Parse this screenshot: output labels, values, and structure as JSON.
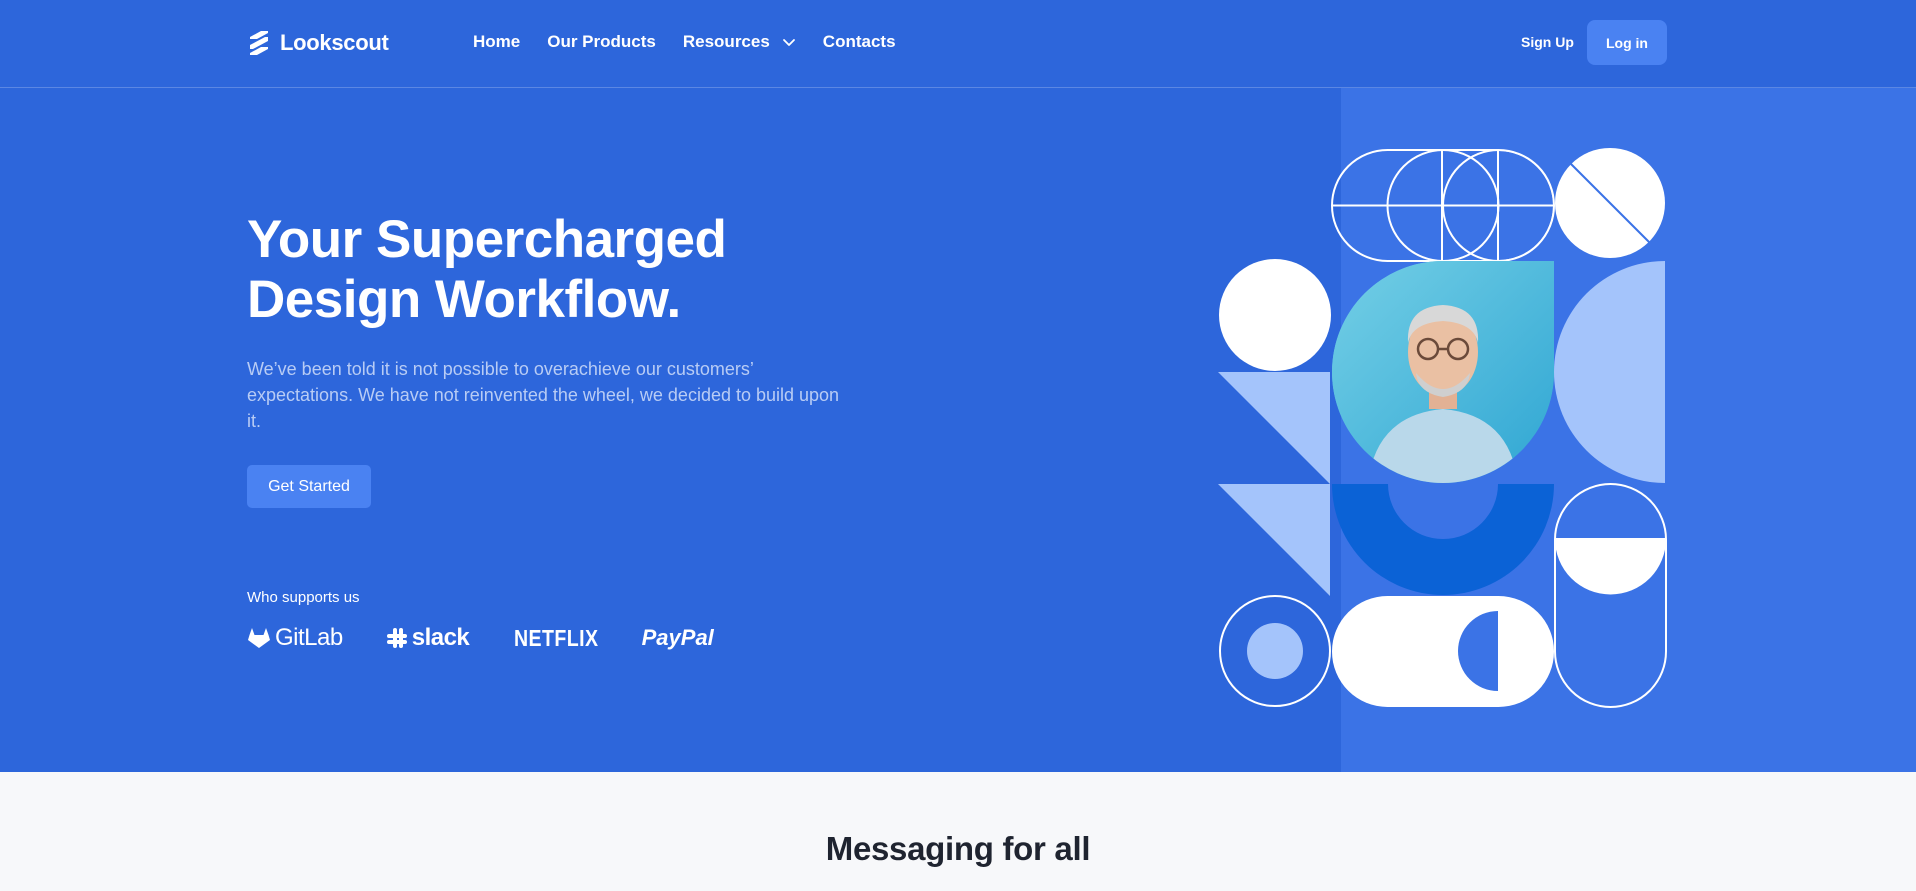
{
  "brand": {
    "name": "Lookscout",
    "logo_icon": "logo-stripes-icon"
  },
  "nav": {
    "items": [
      {
        "label": "Home"
      },
      {
        "label": "Our Products"
      },
      {
        "label": "Resources",
        "has_dropdown": true,
        "icon": "chevron-down-icon"
      },
      {
        "label": "Contacts"
      }
    ]
  },
  "auth": {
    "signup_label": "Sign Up",
    "login_label": "Log in"
  },
  "hero": {
    "title_line1": "Your Supercharged",
    "title_line2": "Design Workflow.",
    "description": "We’ve been told it is not possible to overachieve our customers’ expectations. We have not reinvented the wheel, we decided to build upon it.",
    "cta_label": "Get Started",
    "supporters_label": "Who supports us",
    "supporters": [
      {
        "name": "GitLab",
        "icon": "gitlab-fox-icon"
      },
      {
        "name": "slack",
        "icon": "slack-hash-icon"
      },
      {
        "name": "NETFLIX"
      },
      {
        "name": "PayPal"
      }
    ],
    "illustration": "geometric-shapes-with-portrait"
  },
  "next_section": {
    "title": "Messaging for all"
  },
  "colors": {
    "hero_bg": "#2d66db",
    "hero_right_panel": "#3b73e6",
    "button_bg": "#4a82f2",
    "light_blue": "#a4c4fb",
    "deep_blue": "#0b62d6",
    "text_muted": "#b8ccf5",
    "page_bg": "#f7f8fa",
    "heading_dark": "#1f2430"
  }
}
